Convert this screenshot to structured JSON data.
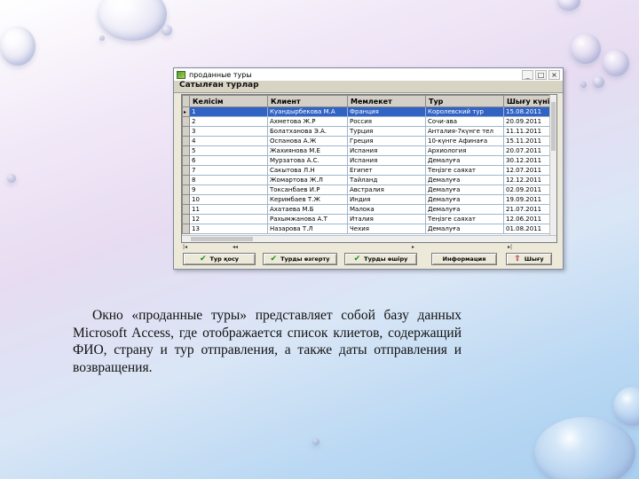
{
  "window": {
    "title": "проданные туры",
    "form_caption": "Сатылған турлар",
    "controls": {
      "minimize": "_",
      "maximize": "□",
      "close": "×"
    }
  },
  "grid": {
    "columns": [
      "Келісім",
      "Клиент",
      "Мемлекет",
      "Тур",
      "Шығу күні"
    ],
    "selected_row": 0,
    "current_row_marker": "▸",
    "rows": [
      [
        "1",
        "Куандырбекова М.А",
        "Франция",
        "Королевский тур",
        "15.08.2011"
      ],
      [
        "2",
        "Ахметова Ж.Р",
        "Россия",
        "Сочи-ава",
        "20.09.2011"
      ],
      [
        "3",
        "Болатханова Э.А.",
        "Турция",
        "Анталия-7күнге тел",
        "11.11.2011"
      ],
      [
        "4",
        "Оспанова А.Ж",
        "Греция",
        "10-күнге Афинаға",
        "15.11.2011"
      ],
      [
        "5",
        "Жахиянова М.Е",
        "Испания",
        "Архиология",
        "20.07.2011"
      ],
      [
        "6",
        "Мурзатова А.С.",
        "Испания",
        "Демалуға",
        "30.12.2011"
      ],
      [
        "7",
        "Сакытова Л.Н",
        "Египет",
        "Теңізге саяхат",
        "12.07.2011"
      ],
      [
        "8",
        "Жомартова Ж.Л",
        "Тайланд",
        "Демалуға",
        "12.12.2011"
      ],
      [
        "9",
        "Токсанбаев И.Р",
        "Австралия",
        "Демалуға",
        "02.09.2011"
      ],
      [
        "10",
        "Керимбаев Т.Ж",
        "Индия",
        "Демалуға",
        "19.09.2011"
      ],
      [
        "11",
        "Ахатаева М.Б",
        "Малока",
        "Демалуға",
        "21.07.2011"
      ],
      [
        "12",
        "Рахымжанова А.Т",
        "Италия",
        "Теңізге саяхат",
        "12.06.2011"
      ],
      [
        "13",
        "Назарова Т.Л",
        "Чехия",
        "Демалуға",
        "01.08.2011"
      ]
    ]
  },
  "navigator": {
    "first": "|◂",
    "prev": "◂◂",
    "next": "▸",
    "last": "▸|"
  },
  "buttons": {
    "add_tour": "Тур қосу",
    "edit_tour": "Турды өзгерту",
    "delete_tour": "Турды өшіру",
    "info": "Информация",
    "exit": "Шығу"
  },
  "caption": "Окно «проданные туры» представляет собой базу данных Microsoft Access, где отображается список клиетов, содержащий ФИО, страну и тур отправления, а также даты отправления и возвращения."
}
